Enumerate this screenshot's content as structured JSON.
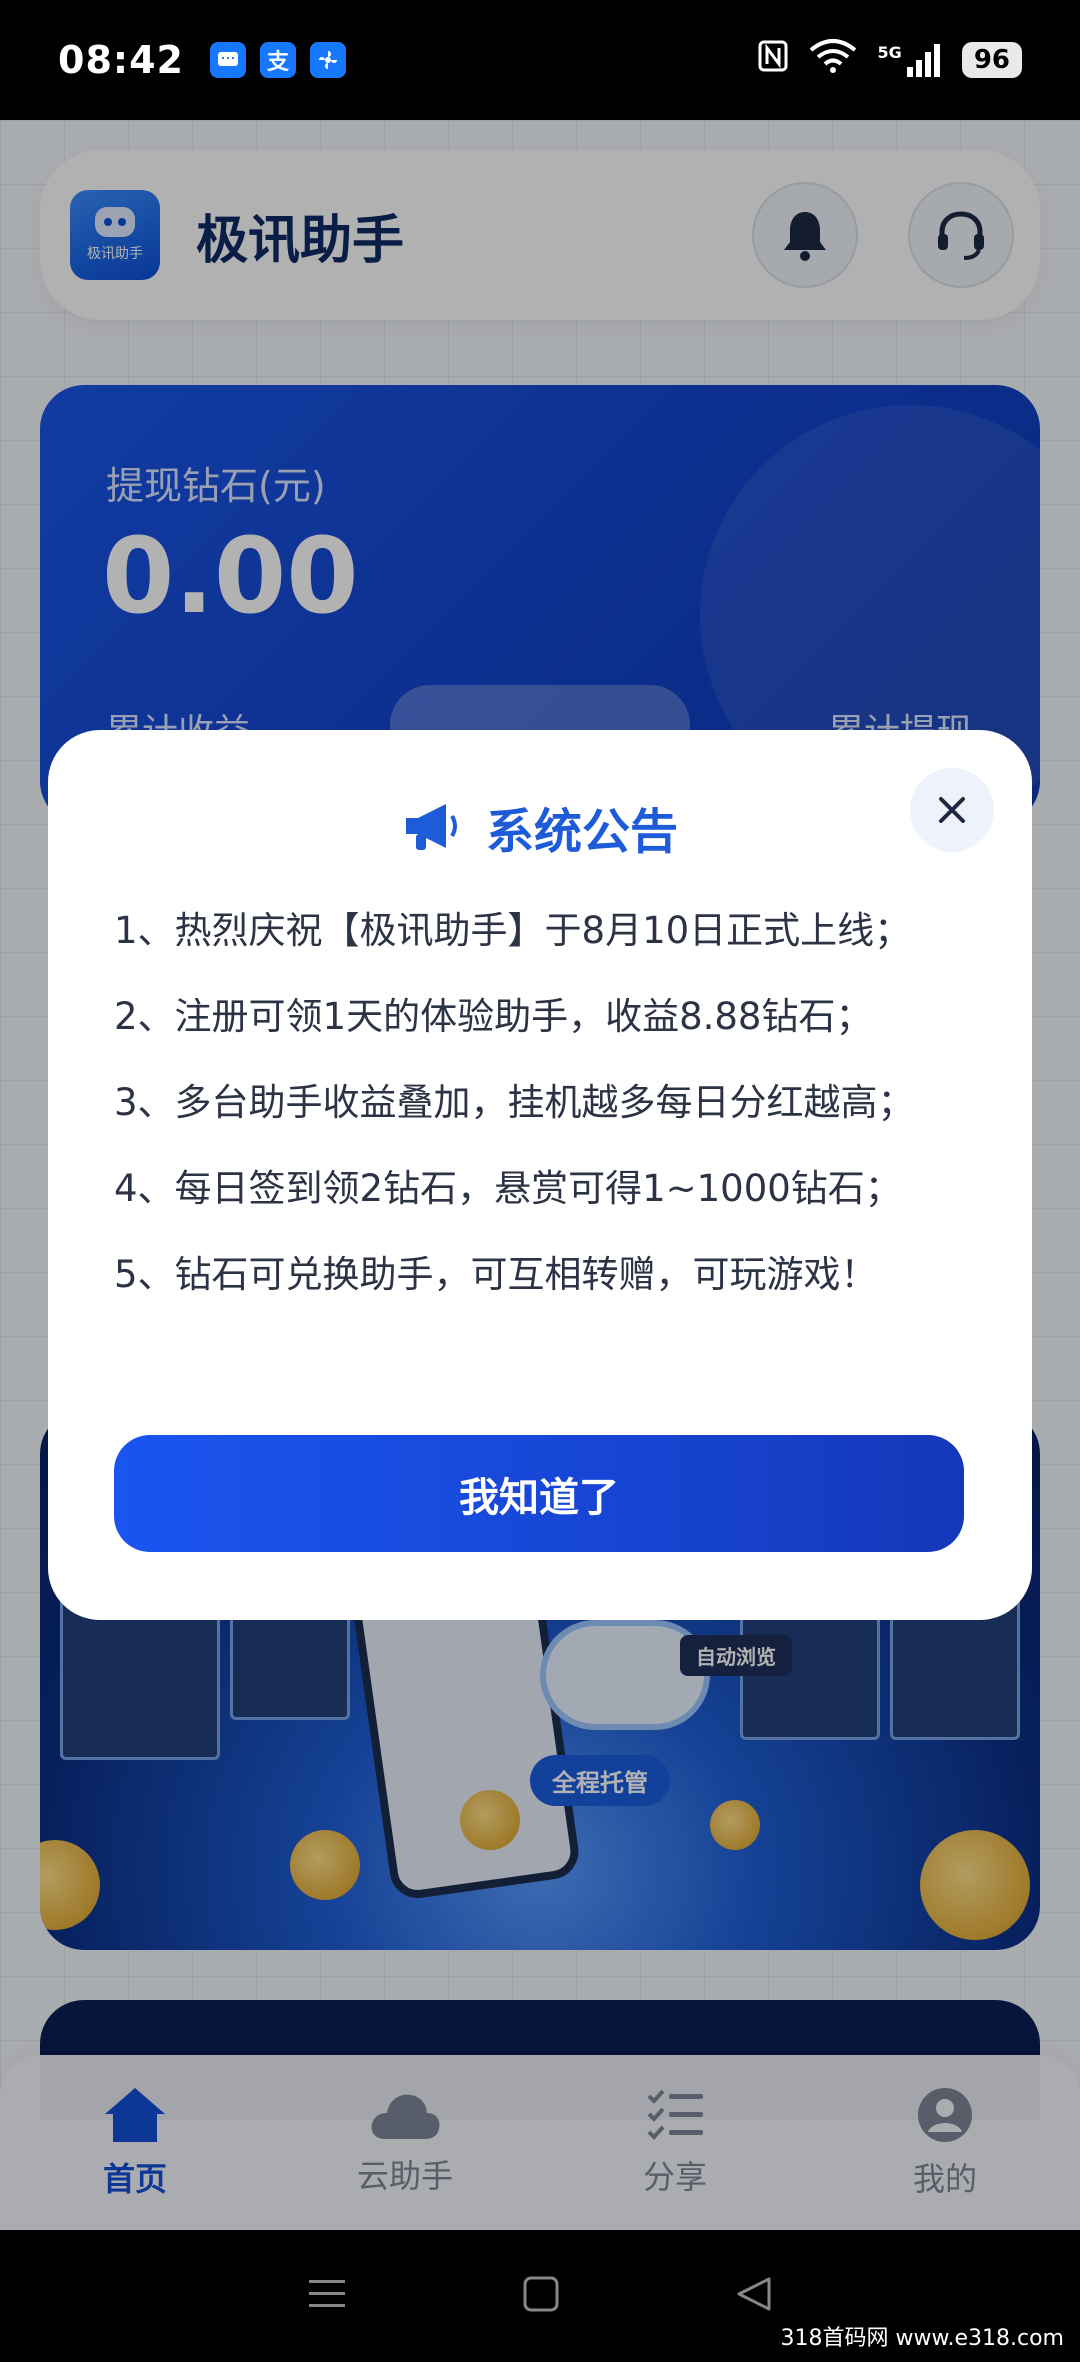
{
  "status_bar": {
    "time": "08:42",
    "notification_icons": [
      "message-app-icon",
      "alipay-icon",
      "fan-app-icon"
    ],
    "alipay_glyph": "支",
    "network": "5G",
    "battery": "96"
  },
  "header": {
    "app_name": "极讯助手",
    "logo_text": "极讯助手"
  },
  "balance_card": {
    "label": "提现钻石(元)",
    "value": "0.00",
    "left_sub": "累计收益",
    "right_sub": "累计提现"
  },
  "banner": {
    "tag_main": "全程托管",
    "tag_side": "自动浏览"
  },
  "tabbar": {
    "items": [
      {
        "label": "首页",
        "icon": "home-icon",
        "active": true
      },
      {
        "label": "云助手",
        "icon": "cloud-icon",
        "active": false
      },
      {
        "label": "分享",
        "icon": "checklist-icon",
        "active": false
      },
      {
        "label": "我的",
        "icon": "user-icon",
        "active": false
      }
    ]
  },
  "modal": {
    "title": "系统公告",
    "lines": [
      "1、热烈庆祝【极讯助手】于8月10日正式上线；",
      "2、注册可领1天的体验助手，收益8.88钻石；",
      "3、多台助手收益叠加，挂机越多每日分红越高；",
      "4、每日签到领2钻石，悬赏可得1~1000钻石；",
      "5、钻石可兑换助手，可互相转赠，可玩游戏！"
    ],
    "confirm_label": "我知道了"
  },
  "watermark": "318首码网 www.e318.com",
  "colors": {
    "accent": "#1a55f0",
    "title_blue": "#1e5bd9",
    "card_blue": "#1242c9",
    "tab_active": "#1450d8",
    "tab_inactive": "#7f8797"
  }
}
